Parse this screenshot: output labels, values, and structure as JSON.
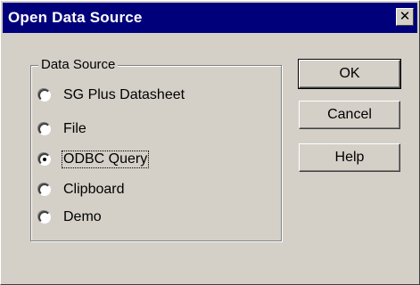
{
  "window": {
    "title": "Open Data Source",
    "close_glyph": "✕"
  },
  "data_source_group": {
    "label": "Data Source",
    "options": [
      {
        "label": "SG Plus Datasheet",
        "selected": false
      },
      {
        "label": "File",
        "selected": false
      },
      {
        "label": "ODBC Query",
        "selected": true
      },
      {
        "label": "Clipboard",
        "selected": false
      },
      {
        "label": "Demo",
        "selected": false
      }
    ]
  },
  "buttons": {
    "ok_label": "OK",
    "cancel_label": "Cancel",
    "help_label": "Help"
  },
  "colors": {
    "titlebar": "#00007a",
    "face": "#d4d0c8"
  }
}
